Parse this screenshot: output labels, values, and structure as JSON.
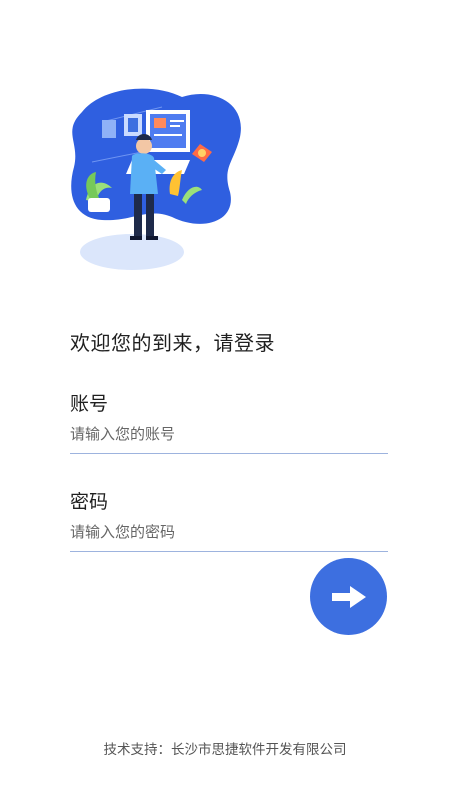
{
  "login": {
    "welcome": "欢迎您的到来，请登录",
    "account": {
      "label": "账号",
      "placeholder": "请输入您的账号"
    },
    "password": {
      "label": "密码",
      "placeholder": "请输入您的密码"
    },
    "submit_icon": "arrow-right-icon"
  },
  "footer": {
    "text": "技术支持：长沙市思捷软件开发有限公司"
  },
  "colors": {
    "accent": "#3d6fe0",
    "underline": "#9db3de"
  }
}
